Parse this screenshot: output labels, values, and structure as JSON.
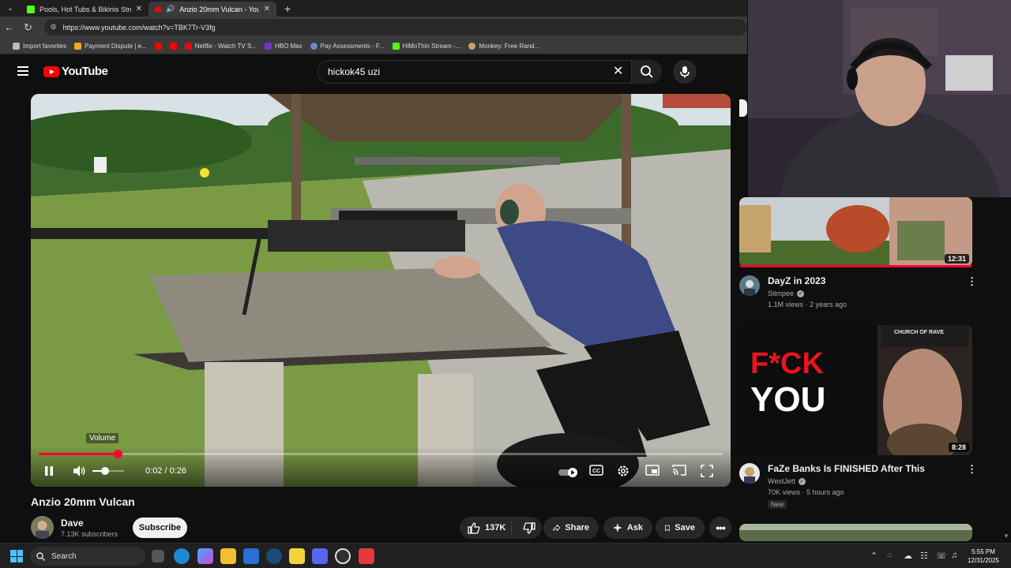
{
  "browser": {
    "tabs": [
      {
        "title": "Pools, Hot Tubs & Bikinis Stream"
      },
      {
        "title": "Anzio 20mm Vulcan - YouTube"
      }
    ],
    "url": "https://www.youtube.com/watch?v=TBK7Tr-V3fg",
    "bookmarks": [
      "Import favorites",
      "Payment Dispute | e...",
      "Netflix - Watch TV S...",
      "HBO Max",
      "Pay Assessments - F...",
      "HiMoThin Stream -...",
      "Monkey: Free Rand..."
    ]
  },
  "youtube": {
    "logo_text": "YouTube",
    "search_query": "hickok45 uzi",
    "player": {
      "volume_tooltip": "Volume",
      "current_time": "0:02",
      "duration": "0:26",
      "time_display": "0:02 / 0:26",
      "progress_fraction": 0.115,
      "volume_fraction": 0.4
    },
    "video": {
      "title": "Anzio 20mm Vulcan",
      "channel": "Dave",
      "subscribers": "7.13K subscribers",
      "subscribe_label": "Subscribe",
      "likes": "137K",
      "share_label": "Share",
      "ask_label": "Ask",
      "save_label": "Save"
    },
    "recommendations": [
      {
        "title": "DayZ in 2023",
        "channel": "Stimpee",
        "meta": "1.1M views · 2 years ago",
        "duration": "12:31"
      },
      {
        "title": "FaZe Banks Is FINISHED After This",
        "channel": "WestJett",
        "meta": "70K views · 5 hours ago",
        "duration": "8:28",
        "badge": "New",
        "thumb_text_1": "F*CK",
        "thumb_text_2": "YOU",
        "thumb_cap": "CHURCH OF RAVE"
      }
    ]
  },
  "taskbar": {
    "search_label": "Search",
    "time": "5:55 PM",
    "date": "12/31/2025"
  },
  "colors": {
    "accent": "#ff0033",
    "background": "#0f0f0f"
  }
}
